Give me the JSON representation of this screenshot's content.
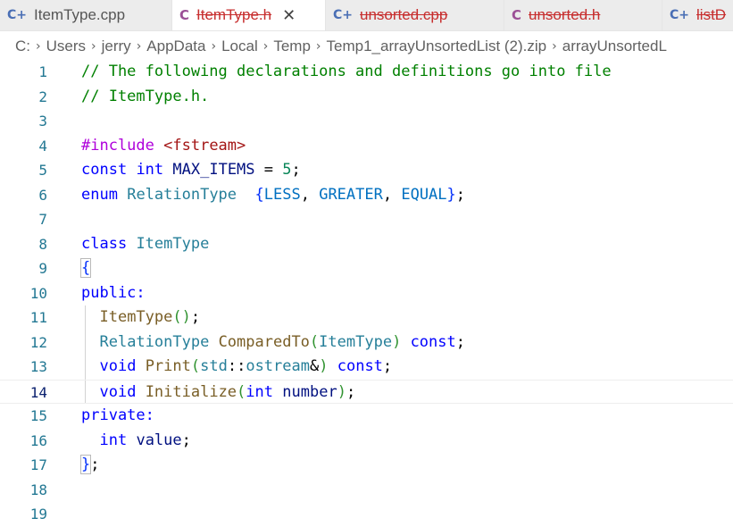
{
  "tabs": [
    {
      "icon": "C+",
      "label": "ItemType.cpp",
      "state": "normal"
    },
    {
      "icon": "C",
      "label": "ItemType.h",
      "state": "active-error",
      "close": "✕"
    },
    {
      "icon": "C+",
      "label": "unsorted.cpp",
      "state": "error"
    },
    {
      "icon": "C",
      "label": "unsorted.h",
      "state": "error"
    },
    {
      "icon": "C+",
      "label": "listD",
      "state": "error"
    }
  ],
  "breadcrumb": [
    "C:",
    "Users",
    "jerry",
    "AppData",
    "Local",
    "Temp",
    "Temp1_arrayUnsortedList (2).zip",
    "arrayUnsortedL"
  ],
  "editor": {
    "current_line": 14,
    "line_numbers": [
      "1",
      "2",
      "3",
      "4",
      "5",
      "6",
      "7",
      "8",
      "9",
      "10",
      "11",
      "12",
      "13",
      "14",
      "15",
      "16",
      "17",
      "18",
      "19"
    ],
    "lines": {
      "l1": "// The following declarations and definitions go into file",
      "l2": "// ItemType.h.",
      "l4_directive": "#include",
      "l4_header": "<fstream>",
      "l5_const": "const",
      "l5_int": "int",
      "l5_name": "MAX_ITEMS",
      "l5_op": " = ",
      "l5_value": "5",
      "l5_semi": ";",
      "l6_enum": "enum",
      "l6_type": "RelationType",
      "l6_open": "{",
      "l6_less": "LESS",
      "l6_greater": "GREATER",
      "l6_equal": "EQUAL",
      "l6_close": "}",
      "l8_class": "class",
      "l8_name": "ItemType",
      "l9_brace": "{",
      "l10_access": "public:",
      "l11_fn": "ItemType",
      "l11_parens": "()",
      "l12_type": "RelationType",
      "l12_fn": "ComparedTo",
      "l12_param": "ItemType",
      "l12_const": "const",
      "l13_void": "void",
      "l13_fn": "Print",
      "l13_ns": "std",
      "l13_type": "ostream",
      "l13_const": "const",
      "l14_void": "void",
      "l14_fn": "Initialize",
      "l14_int": "int",
      "l14_param": "number",
      "l15_access": "private:",
      "l16_int": "int",
      "l16_member": "value",
      "l17_brace": "}"
    }
  }
}
